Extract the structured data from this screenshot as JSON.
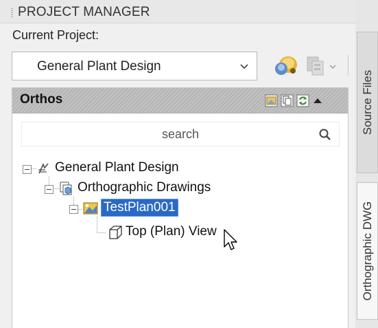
{
  "header": {
    "title": "PROJECT MANAGER"
  },
  "project": {
    "label": "Current Project:",
    "selected": "General Plant Design"
  },
  "panel": {
    "title": "Orthos"
  },
  "search": {
    "placeholder": "search"
  },
  "tree": {
    "root": "General Plant Design",
    "group": "Orthographic Drawings",
    "drawing": "TestPlan001",
    "view": "Top (Plan) View"
  },
  "sidetabs": [
    "Source Files",
    "Orthographic DWG"
  ],
  "colors": {
    "selection": "#2a6ac6",
    "header_band": "#b9b9b9"
  }
}
